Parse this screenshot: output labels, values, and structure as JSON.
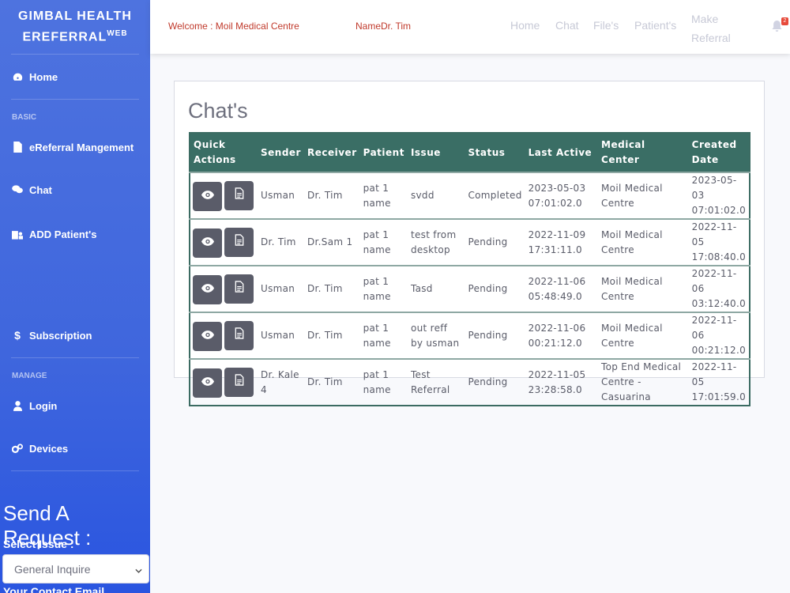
{
  "sidebar": {
    "brand_line1": "GIMBAL HEALTH",
    "brand_line2": "EREFERRAL",
    "brand_sup": "WEB",
    "items": {
      "home": "Home",
      "basic_heading": "BASIC",
      "ereferral": "eReferral Mangement",
      "chat": "Chat",
      "add_patient": "ADD Patient's",
      "subscription": "Subscription",
      "manage_heading": "MANAGE",
      "login": "Login",
      "devices": "Devices"
    },
    "request": {
      "title": "Send A Request :",
      "select_label": "Select Issue :",
      "select_value": "General Inquire",
      "contact_label": "Your Contact Email"
    }
  },
  "topbar": {
    "welcome": "Welcome : Moil Medical Centre",
    "name": "NameDr. Tim",
    "nav": {
      "home": "Home",
      "chat": "Chat",
      "files": "File's",
      "patients": "Patient's",
      "make1": "Make",
      "make2": "Referral"
    },
    "notification_count": "2"
  },
  "main": {
    "title": "Chat's",
    "columns": [
      "Quick Actions",
      "Sender",
      "Receiver",
      "Patient",
      "Issue",
      "Status",
      "Last Active",
      "Medical Center",
      "Created Date"
    ],
    "rows": [
      {
        "sender": "Usman",
        "receiver": "Dr. Tim",
        "patient": "pat 1 name",
        "issue": "svdd",
        "status": "Completed",
        "last_active": "2023-05-03 07:01:02.0",
        "center": "Moil Medical Centre",
        "created": "2023-05-03 07:01:02.0"
      },
      {
        "sender": "Dr. Tim",
        "receiver": "Dr.Sam 1",
        "patient": "pat 1 name",
        "issue": "test from desktop",
        "status": "Pending",
        "last_active": "2022-11-09 17:31:11.0",
        "center": "Moil Medical Centre",
        "created": "2022-11-05 17:08:40.0"
      },
      {
        "sender": "Usman",
        "receiver": "Dr. Tim",
        "patient": "pat 1 name",
        "issue": "Tasd",
        "status": "Pending",
        "last_active": "2022-11-06 05:48:49.0",
        "center": "Moil Medical Centre",
        "created": "2022-11-06 03:12:40.0"
      },
      {
        "sender": "Usman",
        "receiver": "Dr. Tim",
        "patient": "pat 1 name",
        "issue": "out reff by usman",
        "status": "Pending",
        "last_active": "2022-11-06 00:21:12.0",
        "center": "Moil Medical Centre",
        "created": "2022-11-06 00:21:12.0"
      },
      {
        "sender": "Dr. Kale 4",
        "receiver": "Dr. Tim",
        "patient": "pat 1 name",
        "issue": "Test Referral",
        "status": "Pending",
        "last_active": "2022-11-05 23:28:58.0",
        "center": "Top End Medical Centre - Casuarina",
        "created": "2022-11-05 17:01:59.0"
      }
    ]
  }
}
